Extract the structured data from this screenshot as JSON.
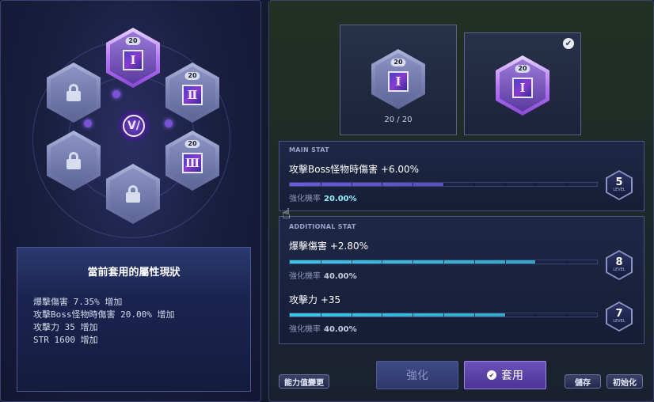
{
  "left": {
    "runes": [
      {
        "level": "20",
        "numeral": "Ⅰ",
        "state": "active"
      },
      {
        "level": "20",
        "numeral": "Ⅱ",
        "state": "unlocked"
      },
      {
        "level": "20",
        "numeral": "Ⅲ",
        "state": "unlocked"
      },
      {
        "state": "locked"
      },
      {
        "state": "locked"
      },
      {
        "state": "locked"
      }
    ],
    "emblem": "V/",
    "current_title": "當前套用的屬性現狀",
    "current_stats": [
      "爆擊傷害 7.35% 增加",
      "攻擊Boss怪物時傷害 20.00% 增加",
      "攻擊力 35 增加",
      "STR 1600 增加"
    ]
  },
  "right": {
    "slot1": {
      "level": "20",
      "numeral": "Ⅰ",
      "count": "20 / 20"
    },
    "slot2": {
      "level": "20",
      "numeral": "Ⅰ",
      "check": "✔"
    },
    "main_stat": {
      "section_label": "MAIN STAT",
      "name": "攻擊Boss怪物時傷害 +6.00%",
      "rate_label": "強化機率",
      "rate_value": "20.00%",
      "progress": 0.5,
      "level": "5",
      "level_label": "LEVEL"
    },
    "additional": {
      "section_label": "ADDITIONAL STAT",
      "stats": [
        {
          "name": "爆擊傷害 +2.80%",
          "rate_label": "強化機率",
          "rate_value": "40.00%",
          "progress": 0.8,
          "level": "8",
          "level_label": "LEVEL"
        },
        {
          "name": "攻擊力 +35",
          "rate_label": "強化機率",
          "rate_value": "40.00%",
          "progress": 0.7,
          "level": "7",
          "level_label": "LEVEL"
        }
      ]
    },
    "buttons": {
      "change": "能力值變更",
      "enhance": "強化",
      "apply": "套用",
      "save": "儲存",
      "reset": "初始化"
    }
  },
  "colors": {
    "main_bar": "#6a5ae0",
    "additional_bar": "#3ac8e8",
    "rate_main": "#8ff0ff",
    "rate_add": "#c8cce0"
  }
}
